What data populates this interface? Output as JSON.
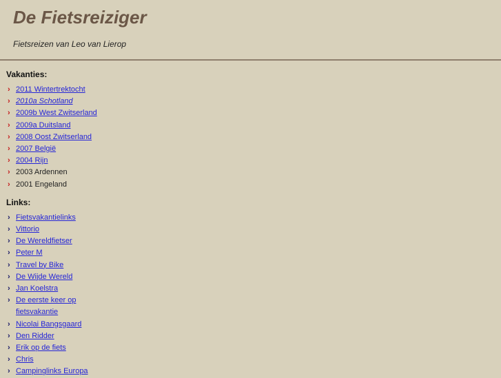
{
  "header": {
    "title": "De Fietsreiziger",
    "tagline": "Fietsreizen van Leo van Lierop"
  },
  "vakanties": {
    "heading": "Vakanties:",
    "items": [
      {
        "label": "2011 Wintertrektocht",
        "link": true
      },
      {
        "label": "2010a Schotland",
        "link": true,
        "italic": true
      },
      {
        "label": "2009b West Zwitserland",
        "link": true
      },
      {
        "label": "2009a Duitsland",
        "link": true
      },
      {
        "label": "2008 Oost Zwitserland",
        "link": true
      },
      {
        "label": "2007 België",
        "link": true
      },
      {
        "label": "2004 Rijn",
        "link": true
      },
      {
        "label": "2003 Ardennen",
        "link": false
      },
      {
        "label": "2001 Engeland",
        "link": false
      }
    ]
  },
  "links": {
    "heading": "Links:",
    "items": [
      {
        "label": "Fietsvakantielinks"
      },
      {
        "label": "Vittorio"
      },
      {
        "label": "De Wereldfietser"
      },
      {
        "label": "Peter M"
      },
      {
        "label": "Travel by Bike"
      },
      {
        "label": "De Wijde Wereld"
      },
      {
        "label": "Jan Koelstra"
      },
      {
        "label": "De eerste keer op fietsvakantie"
      },
      {
        "label": "Nicolai Bangsgaard"
      },
      {
        "label": "Den Ridder"
      },
      {
        "label": "Erik op de fiets"
      },
      {
        "label": "Chris"
      },
      {
        "label": "Campinglinks Europa"
      }
    ]
  },
  "icons": {
    "bullet": "›"
  },
  "colors": {
    "background": "#d8d1bb",
    "title": "#6b5747",
    "link": "#2424d8",
    "bullet_vakanties": "#c41a1a",
    "bullet_links": "#1a1a66"
  }
}
